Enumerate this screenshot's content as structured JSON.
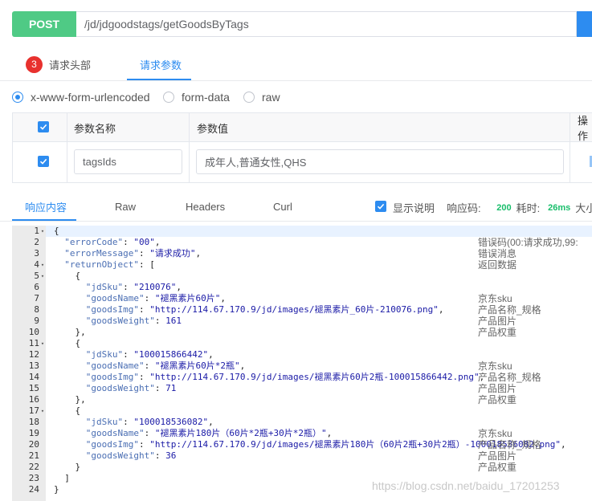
{
  "request": {
    "method": "POST",
    "url": "/jd/jdgoodstags/getGoodsByTags",
    "tabs": {
      "headers_badge": "3",
      "headers_label": "请求头部",
      "params_label": "请求参数"
    },
    "body_types": [
      "x-www-form-urlencoded",
      "form-data",
      "raw"
    ],
    "selected_body_type": "x-www-form-urlencoded",
    "params": {
      "headers": {
        "name": "参数名称",
        "value": "参数值",
        "action": "操作"
      },
      "rows": [
        {
          "checked": true,
          "name": "tagsIds",
          "value": "成年人,普通女性,QHS"
        }
      ]
    }
  },
  "response": {
    "tabs": [
      "响应内容",
      "Raw",
      "Headers",
      "Curl"
    ],
    "show_desc_label": "显示说明",
    "status_label": "响应码:",
    "status_code": "200",
    "time_label": "耗时:",
    "time_value": "26ms",
    "size_label": "大小",
    "line_numbers": [
      "1",
      "2",
      "3",
      "4",
      "5",
      "6",
      "7",
      "8",
      "9",
      "10",
      "11",
      "12",
      "13",
      "14",
      "15",
      "16",
      "17",
      "18",
      "19",
      "20",
      "21",
      "22",
      "23",
      "24"
    ],
    "descriptions": {
      "2": "错误码(00:请求成功,99:",
      "3": "错误消息",
      "4": "返回数据",
      "7": "京东sku",
      "8": "产品名称_规格",
      "9": "产品图片",
      "10": "产品权重",
      "13": "京东sku",
      "14": "产品名称_规格",
      "15": "产品图片",
      "16": "产品权重",
      "19": "京东sku",
      "20": "产品名称_规格",
      "21": "产品图片",
      "22": "产品权重"
    },
    "body": {
      "errorCode": "00",
      "errorMessage": "请求成功",
      "returnObject": [
        {
          "jdSku": "210076",
          "goodsName": "褪黑素片60片",
          "goodsImg": "http://114.67.170.9/jd/images/褪黑素片_60片-210076.png",
          "goodsWeight": "161"
        },
        {
          "jdSku": "100015866442",
          "goodsName": "褪黑素片60片*2瓶",
          "goodsImg": "http://114.67.170.9/jd/images/褪黑素片60片2瓶-100015866442.png",
          "goodsWeight": "71"
        },
        {
          "jdSku": "100018536082",
          "goodsName": "褪黑素片180片（60片*2瓶+30片*2瓶）",
          "goodsImg": "http://114.67.170.9/jd/images/褪黑素片180片（60片2瓶+30片2瓶）-100018536082.png",
          "goodsWeight": "36"
        }
      ]
    }
  },
  "watermark": "https://blog.csdn.net/baidu_17201253",
  "colors": {
    "post": "#4fca85",
    "accent": "#2d8cf0",
    "badge": "#e8312e",
    "success": "#19be6b"
  }
}
